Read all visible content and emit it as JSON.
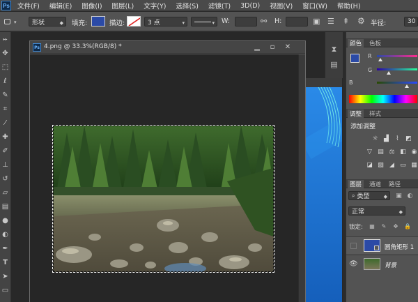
{
  "app": {
    "logo_text": "Ps",
    "menu": [
      "文件(F)",
      "编辑(E)",
      "图像(I)",
      "图层(L)",
      "文字(Y)",
      "选择(S)",
      "滤镜(T)",
      "3D(D)",
      "视图(V)",
      "窗口(W)",
      "帮助(H)"
    ]
  },
  "options": {
    "mode": "形状",
    "fill_label": "填充:",
    "stroke_label": "描边:",
    "stroke_width": "3 点",
    "w_label": "W:",
    "h_label": "H:",
    "radius_label": "半径:",
    "radius_value": "30",
    "fill_color": "#2b4aa6"
  },
  "document": {
    "ps_badge": "Ps",
    "title": "4.png @ 33.3%(RGB/8) *"
  },
  "panels": {
    "color_tabs": [
      "颜色",
      "色板"
    ],
    "channel_r": "R",
    "channel_g": "G",
    "channel_b": "B",
    "adjust_tabs": [
      "调整",
      "样式"
    ],
    "adjust_title": "添加调整",
    "layer_tabs": [
      "图层",
      "通道",
      "路径"
    ],
    "filter_kind": "类型",
    "blend_mode": "正常",
    "lock_label": "锁定:",
    "layers": [
      {
        "name": "圆角矩形 1"
      },
      {
        "name": "背景"
      }
    ]
  }
}
